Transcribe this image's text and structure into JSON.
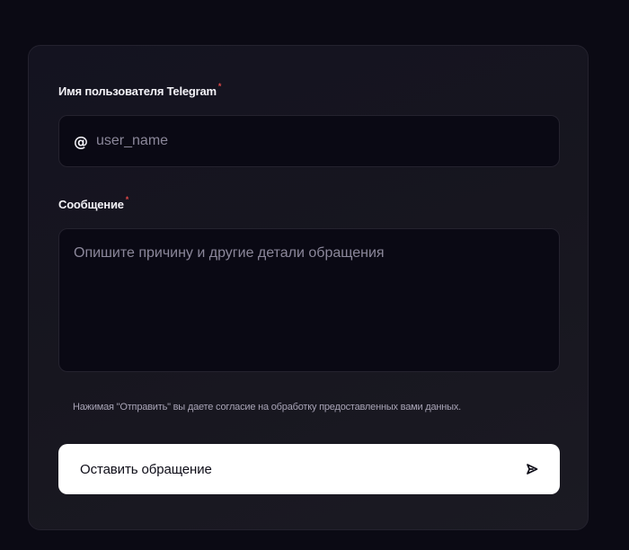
{
  "form": {
    "username_label": "Имя пользователя Telegram",
    "username_required": "*",
    "username_prefix": "@",
    "username_placeholder": "user_name",
    "message_label": "Сообщение",
    "message_required": "*",
    "message_placeholder": "Опишите причину и другие детали обращения",
    "consent_text": "Нажимая \"Отправить\" вы даете согласие на обработку предоставленных вами данных.",
    "submit_label": "Оставить обращение",
    "submit_icon": "send-icon"
  },
  "colors": {
    "background": "#0b0a14",
    "card": "#17161f",
    "input_bg": "#0a0914",
    "required": "#e04848",
    "button_bg": "#ffffff",
    "button_text": "#0d0c17"
  }
}
